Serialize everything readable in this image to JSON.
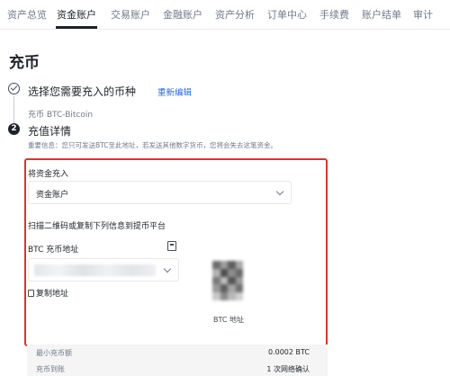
{
  "nav": {
    "items": [
      "资产总览",
      "资金账户",
      "交易账户",
      "金融账户",
      "资产分析",
      "订单中心",
      "手续费",
      "账户结单",
      "审计"
    ],
    "active_index": 1
  },
  "page": {
    "title": "充币"
  },
  "step1": {
    "title": "选择您需要充入的币种",
    "reselect_label": "重新编辑",
    "selected_coin": "充币 BTC-Bitcoin"
  },
  "step2": {
    "number": "2",
    "title": "充值详情",
    "notice": "重要信息：您只可发送BTC至此地址，若发送其他数字货币，您将会失去这笔资金。",
    "account_label": "将资金充入",
    "account_value": "资金账户",
    "scan_instruction": "扫描二维码或复制下列信息到提币平台",
    "address_label": "BTC 充币地址",
    "copy_label": "复制地址",
    "qr_caption": "BTC 地址"
  },
  "info_table": [
    {
      "key": "最小充币额",
      "value": "0.0002 BTC"
    },
    {
      "key": "充币到账",
      "value": "1 次网络确认"
    }
  ],
  "colors": {
    "highlight": "#d9352f",
    "link": "#2f6bd6",
    "text": "#1e2329",
    "muted": "#707a8a"
  }
}
